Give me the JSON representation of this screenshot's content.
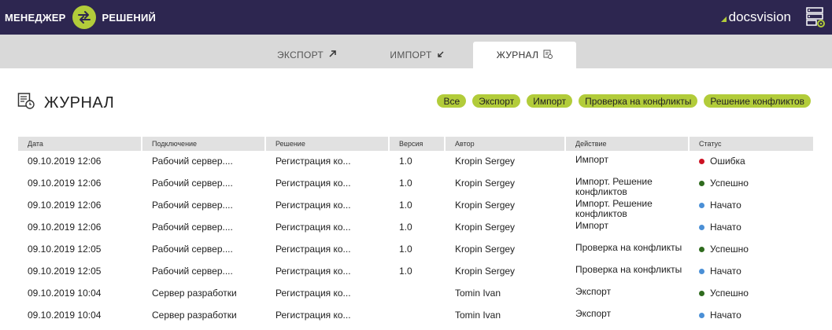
{
  "header": {
    "left_word1": "МЕНЕДЖЕР",
    "left_word2": "РЕШЕНИЙ",
    "brand": "docsvision",
    "icons": {
      "logo": "arrows-exchange-icon",
      "settings": "server-gear-icon"
    },
    "colors": {
      "bar": "#2d2650",
      "accent": "#b2cc3a"
    }
  },
  "tabs": [
    {
      "label": "ЭКСПОРТ",
      "icon": "arrow-up-right-icon"
    },
    {
      "label": "ИМПОРТ",
      "icon": "arrow-down-left-icon"
    },
    {
      "label": "ЖУРНАЛ",
      "icon": "journal-icon",
      "active": true
    }
  ],
  "page": {
    "title": "ЖУРНАЛ",
    "icon": "journal-clock-icon"
  },
  "filters": [
    "Все",
    "Экспорт",
    "Импорт",
    "Проверка на конфликты",
    "Решение конфликтов"
  ],
  "table": {
    "headers": [
      "Дата",
      "Подключение",
      "Решение",
      "Версия",
      "Автор",
      "Действие",
      "Статус"
    ],
    "status_colors": {
      "Ошибка": "#cc1122",
      "Успешно": "#2f6b1e",
      "Начато": "#4a8fd6"
    },
    "rows": [
      {
        "date": "09.10.2019 12:06",
        "connection": "Рабочий сервер....",
        "solution": "Регистрация ко...",
        "version": "1.0",
        "author": "Kropin Sergey",
        "action": "Импорт",
        "status": "Ошибка"
      },
      {
        "date": "09.10.2019 12:06",
        "connection": "Рабочий сервер....",
        "solution": "Регистрация ко...",
        "version": "1.0",
        "author": "Kropin Sergey",
        "action": "Импорт. Решение конфликтов",
        "status": "Успешно"
      },
      {
        "date": "09.10.2019 12:06",
        "connection": "Рабочий сервер....",
        "solution": "Регистрация ко...",
        "version": "1.0",
        "author": "Kropin Sergey",
        "action": "Импорт. Решение конфликтов",
        "status": "Начато"
      },
      {
        "date": "09.10.2019 12:06",
        "connection": "Рабочий сервер....",
        "solution": "Регистрация ко...",
        "version": "1.0",
        "author": "Kropin Sergey",
        "action": "Импорт",
        "status": "Начато"
      },
      {
        "date": "09.10.2019 12:05",
        "connection": "Рабочий сервер....",
        "solution": "Регистрация ко...",
        "version": "1.0",
        "author": "Kropin Sergey",
        "action": "Проверка на конфликты",
        "status": "Успешно"
      },
      {
        "date": "09.10.2019 12:05",
        "connection": "Рабочий сервер....",
        "solution": "Регистрация ко...",
        "version": "1.0",
        "author": "Kropin Sergey",
        "action": "Проверка на конфликты",
        "status": "Начато"
      },
      {
        "date": "09.10.2019 10:04",
        "connection": "Сервер разработки",
        "solution": "Регистрация ко...",
        "version": "",
        "author": "Tomin Ivan",
        "action": "Экспорт",
        "status": "Успешно"
      },
      {
        "date": "09.10.2019 10:04",
        "connection": "Сервер разработки",
        "solution": "Регистрация ко...",
        "version": "",
        "author": "Tomin Ivan",
        "action": "Экспорт",
        "status": "Начато"
      }
    ]
  }
}
